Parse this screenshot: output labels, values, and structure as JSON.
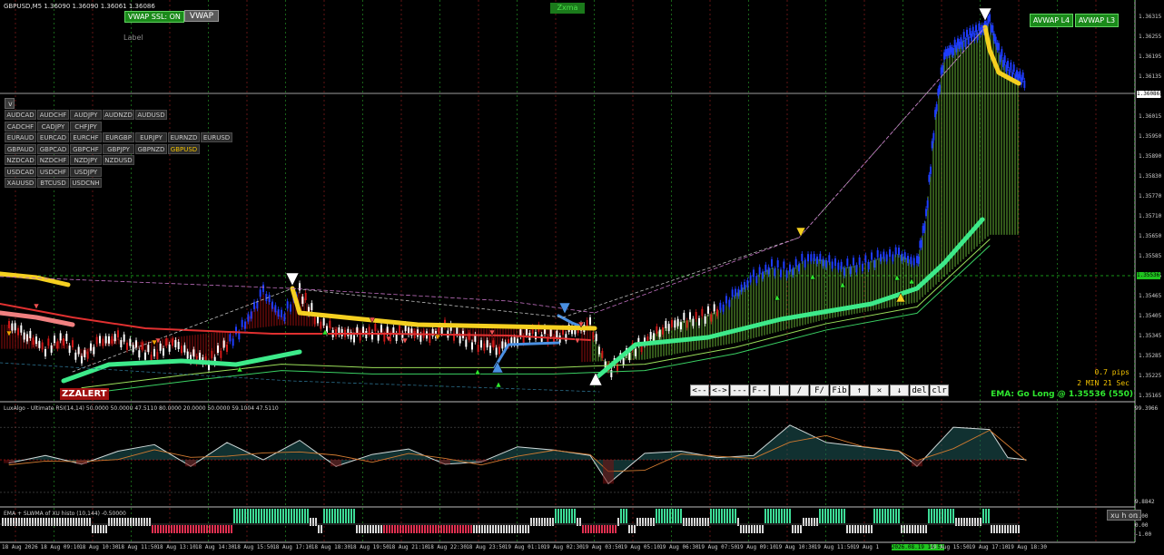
{
  "header": {
    "symbol_line": "GBPUSD,M5  1.36090 1.36090 1.36061 1.36086",
    "label": "Label",
    "zone_label": "Zxma"
  },
  "buttons": {
    "vwap_ssl": "VWAP SSL: ON",
    "vwap": "VWAP",
    "avwap_l4": "AVWAP L4",
    "avwap_l3": "AVWAP L3",
    "xu_h_on": "xu h on",
    "collapse": "v"
  },
  "symbols": [
    [
      "AUDCAD",
      "AUDCHF",
      "AUDJPY",
      "AUDNZD",
      "AUDUSD"
    ],
    [
      "CADCHF",
      "CADJPY",
      "CHFJPY"
    ],
    [
      "EURAUD",
      "EURCAD",
      "EURCHF",
      "EURGBP",
      "EURJPY",
      "EURNZD",
      "EURUSD"
    ],
    [
      "GBPAUD",
      "GBPCAD",
      "GBPCHF",
      "GBPJPY",
      "GBPNZD",
      "GBPUSD"
    ],
    [
      "NZDCAD",
      "NZDCHF",
      "NZDJPY",
      "NZDUSD"
    ],
    [
      "USDCAD",
      "USDCHF",
      "USDJPY"
    ],
    [
      "XAUUSD",
      "BTCUSD",
      "USDCNH"
    ]
  ],
  "active_symbol": "GBPUSD",
  "toolbar": [
    "<--",
    "<->",
    "---",
    "F--",
    "|",
    "/",
    "F/",
    "Fib",
    "↑",
    "✕",
    "↓",
    "del",
    "clr"
  ],
  "info": {
    "pips": "0.7 pips",
    "timer": "2 MIN 21 Sec",
    "ema_signal": "EMA: Go Long @ 1.35536 (550)",
    "zzalert": "ZZALERT"
  },
  "price_axis": [
    "1.36315",
    "1.36255",
    "1.36195",
    "1.36135",
    "1.36075",
    "1.36015",
    "1.35950",
    "1.35890",
    "1.35830",
    "1.35770",
    "1.35710",
    "1.35650",
    "1.35585",
    "1.35525",
    "1.35465",
    "1.35405",
    "1.35345",
    "1.35285",
    "1.35225",
    "1.35165"
  ],
  "price_markers": {
    "current": "1.36086",
    "ema_level": "1.35536"
  },
  "rsi": {
    "title": "LuxAlgo - Ultimate RSI(14,14) 50.0000 50.0000 47.5110 80.0000 20.0000 50.0000 59.1004 47.5110",
    "axis_top": "99.3966",
    "axis_bottom": "9.8842"
  },
  "histo": {
    "title": "EMA + SLWMA of XU histo (10,144) -0.50000",
    "axis": [
      "1.00",
      "0.00",
      "-1.00"
    ]
  },
  "time_axis": [
    "18 Aug 2026",
    "18 Aug 09:10",
    "18 Aug 10:30",
    "18 Aug 11:50",
    "18 Aug 13:10",
    "18 Aug 14:30",
    "18 Aug 15:50",
    "18 Aug 17:10",
    "18 Aug 18:30",
    "18 Aug 19:50",
    "18 Aug 21:10",
    "18 Aug 22:30",
    "18 Aug 23:50",
    "19 Aug 01:10",
    "19 Aug 02:30",
    "19 Aug 03:50",
    "19 Aug 05:10",
    "19 Aug 06:30",
    "19 Aug 07:50",
    "19 Aug 09:10",
    "19 Aug 10:30",
    "19 Aug 11:50",
    "19 Aug 1",
    "2026.08.19 14:50",
    "19 Aug 15:50",
    "19 Aug 17:10",
    "19 Aug 18:30"
  ],
  "colors": {
    "bull": "#1e3cff",
    "bear": "#d01818",
    "neutral": "#ffffff",
    "ema_green": "#3dea8a",
    "ema_yellow": "#f5d020",
    "ribbon_green": "#6fc23a",
    "ribbon_red": "#a01010",
    "grid_green": "#1f7a1f",
    "grid_red": "#7a1a1a"
  },
  "chart_data": [
    {
      "type": "line",
      "title": "",
      "series": [
        {
          "name": "GBPUSD M5 Close",
          "x": [
            0,
            20,
            40,
            60,
            80,
            100,
            120,
            140,
            160,
            180,
            200,
            220,
            240,
            260,
            280,
            300,
            320,
            340,
            360,
            380,
            400,
            420,
            440,
            460,
            480,
            500,
            520,
            540,
            560,
            580,
            600,
            620,
            640,
            660,
            680,
            700,
            720,
            740,
            760,
            780,
            800,
            820,
            840,
            860,
            880,
            900,
            920,
            940,
            960,
            980,
            1000,
            1010,
            1020,
            1030,
            1040,
            1050,
            1060,
            1070,
            1080,
            1090,
            1100,
            1110,
            1120
          ],
          "values": [
            1.3538,
            1.3535,
            1.3531,
            1.3534,
            1.3528,
            1.3533,
            1.3534,
            1.3531,
            1.3529,
            1.3533,
            1.3529,
            1.3527,
            1.3532,
            1.3538,
            1.3548,
            1.354,
            1.3548,
            1.3539,
            1.3536,
            1.3535,
            1.3536,
            1.3535,
            1.3536,
            1.3534,
            1.3537,
            1.3534,
            1.3532,
            1.3531,
            1.3534,
            1.3536,
            1.3534,
            1.3536,
            1.3538,
            1.3524,
            1.3529,
            1.3533,
            1.3537,
            1.3539,
            1.354,
            1.3542,
            1.3547,
            1.3552,
            1.3555,
            1.3554,
            1.3558,
            1.3557,
            1.3555,
            1.3556,
            1.3558,
            1.3559,
            1.3556,
            1.357,
            1.36,
            1.3618,
            1.362,
            1.3622,
            1.3624,
            1.3625,
            1.3628,
            1.3619,
            1.3614,
            1.3612,
            1.361
          ]
        },
        {
          "name": "EMA",
          "x": [
            80,
            200,
            300,
            400,
            500,
            600,
            700,
            800,
            900,
            1000,
            1040,
            1080
          ],
          "values": [
            1.3526,
            1.353,
            1.3533,
            1.3532,
            1.3532,
            1.3532,
            1.3533,
            1.3538,
            1.3545,
            1.355,
            1.356,
            1.357
          ]
        }
      ],
      "ylim": [
        1.35165,
        1.36315
      ]
    },
    {
      "type": "area",
      "title": "",
      "series": [
        {
          "name": "Ultimate RSI",
          "x": [
            0,
            40,
            80,
            120,
            160,
            200,
            240,
            280,
            320,
            360,
            400,
            440,
            480,
            520,
            560,
            600,
            640,
            660,
            700,
            740,
            780,
            820,
            860,
            900,
            940,
            980,
            1000,
            1040,
            1080,
            1100,
            1120
          ],
          "values": [
            47,
            54,
            46,
            58,
            64,
            44,
            66,
            50,
            68,
            44,
            55,
            60,
            46,
            48,
            62,
            59,
            54,
            28,
            56,
            58,
            52,
            54,
            82,
            66,
            62,
            58,
            44,
            80,
            78,
            52,
            50
          ]
        }
      ],
      "ylim": [
        9.8842,
        99.3966
      ]
    }
  ]
}
